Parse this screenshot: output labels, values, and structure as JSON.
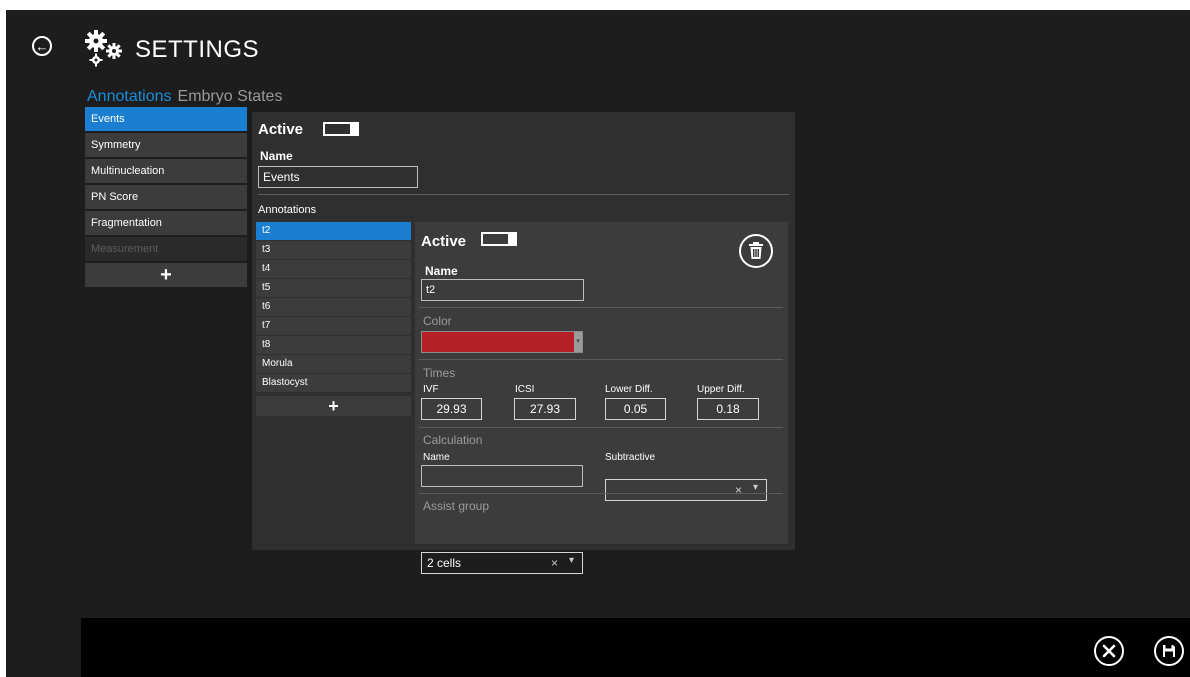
{
  "header": {
    "title": "SETTINGS",
    "back_icon": "arrow-left-circle-icon",
    "settings_icon": "gears-icon"
  },
  "tabs": [
    {
      "label": "Annotations",
      "active": true
    },
    {
      "label": "Embryo States",
      "active": false
    }
  ],
  "sidebar": {
    "items": [
      {
        "label": "Events",
        "selected": true
      },
      {
        "label": "Symmetry"
      },
      {
        "label": "Multinucleation"
      },
      {
        "label": "PN Score"
      },
      {
        "label": "Fragmentation"
      },
      {
        "label": "Measurement",
        "disabled": true
      }
    ],
    "add_label": "+"
  },
  "main": {
    "active_label": "Active",
    "active_state": true,
    "name_label": "Name",
    "name_value": "Events",
    "annotations_label": "Annotations",
    "annotations": [
      "t2",
      "t3",
      "t4",
      "t5",
      "t6",
      "t7",
      "t8",
      "Morula",
      "Blastocyst"
    ],
    "annotations_add_label": "+"
  },
  "detail": {
    "active_label": "Active",
    "active_state": true,
    "name_label": "Name",
    "name_value": "t2",
    "color_label": "Color",
    "color_value": "#b52026",
    "times_label": "Times",
    "times": [
      {
        "label": "IVF",
        "value": "29.93"
      },
      {
        "label": "ICSI",
        "value": "27.93"
      },
      {
        "label": "Lower Diff.",
        "value": "0.05"
      },
      {
        "label": "Upper Diff.",
        "value": "0.18"
      }
    ],
    "calculation_label": "Calculation",
    "calc_name_label": "Name",
    "calc_name_value": "",
    "subtractive_label": "Subtractive",
    "subtractive_value": "",
    "assist_group_label": "Assist group",
    "assist_group_value": "2 cells",
    "clear_glyph": "×",
    "dropdown_glyph": "▾",
    "delete_icon": "trash-icon"
  },
  "footer": {
    "cancel_icon": "close-circle-icon",
    "save_icon": "floppy-disk-icon"
  },
  "colors": {
    "accent": "#1a7fd1",
    "background": "#1d1d1d",
    "panel": "#2f2f2f",
    "subpanel": "#3c3c3c"
  }
}
